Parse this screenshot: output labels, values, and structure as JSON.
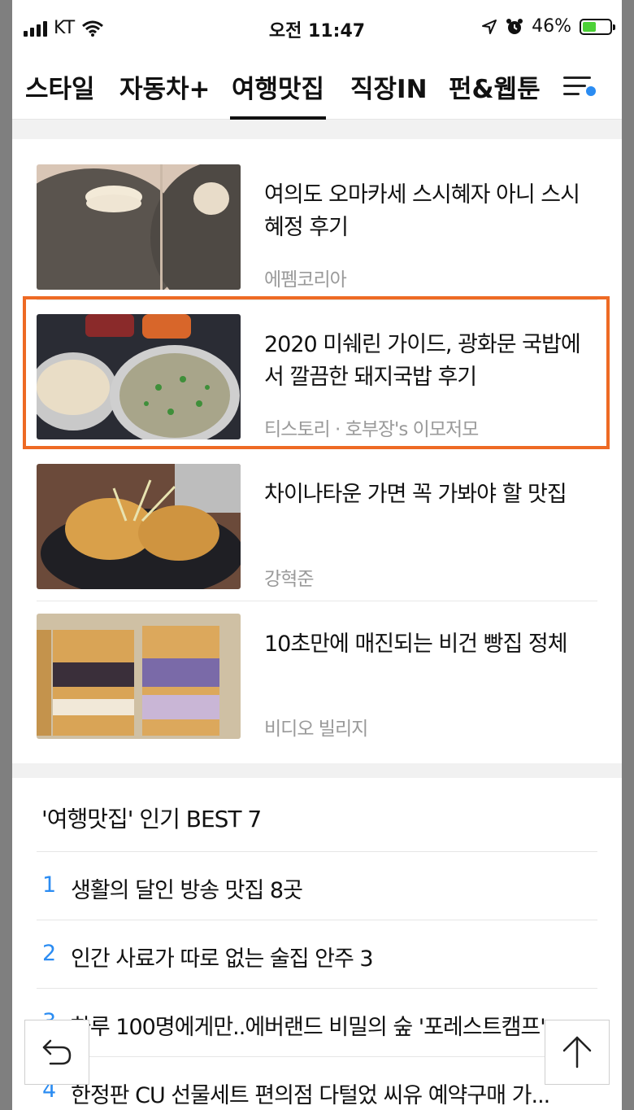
{
  "status_bar": {
    "carrier": "KT",
    "time": "오전 11:47",
    "battery": "46%"
  },
  "tabs": [
    {
      "label": "스타일"
    },
    {
      "label": "자동차+"
    },
    {
      "label": "여행맛집"
    },
    {
      "label": "직장IN"
    },
    {
      "label": "펀&웹툰"
    }
  ],
  "articles": [
    {
      "title": "여의도 오마카세 스시혜자 아니 스시혜정 후기",
      "source": "에펨코리아"
    },
    {
      "title": "2020 미쉐린 가이드, 광화문 국밥에서 깔끔한 돼지국밥 후기",
      "source": "티스토리 · 호부장's 이모저모"
    },
    {
      "title": "차이나타운 가면 꼭 가봐야 할 맛집",
      "source": "강혁준"
    },
    {
      "title": "10초만에 매진되는 비건 빵집 정체",
      "source": "비디오 빌리지"
    }
  ],
  "best": {
    "title": "'여행맛집' 인기 BEST 7",
    "items": [
      {
        "rank": "1",
        "text": "생활의 달인 방송 맛집 8곳"
      },
      {
        "rank": "2",
        "text": "인간 사료가 따로 없는 술집 안주 3"
      },
      {
        "rank": "3",
        "text": "하루 100명에게만..에버랜드 비밀의 숲 '포레스트캠프'"
      },
      {
        "rank": "4",
        "text": "한정판 CU 선물세트 편의점 다털었 씨유 예약구매 가..."
      }
    ]
  }
}
